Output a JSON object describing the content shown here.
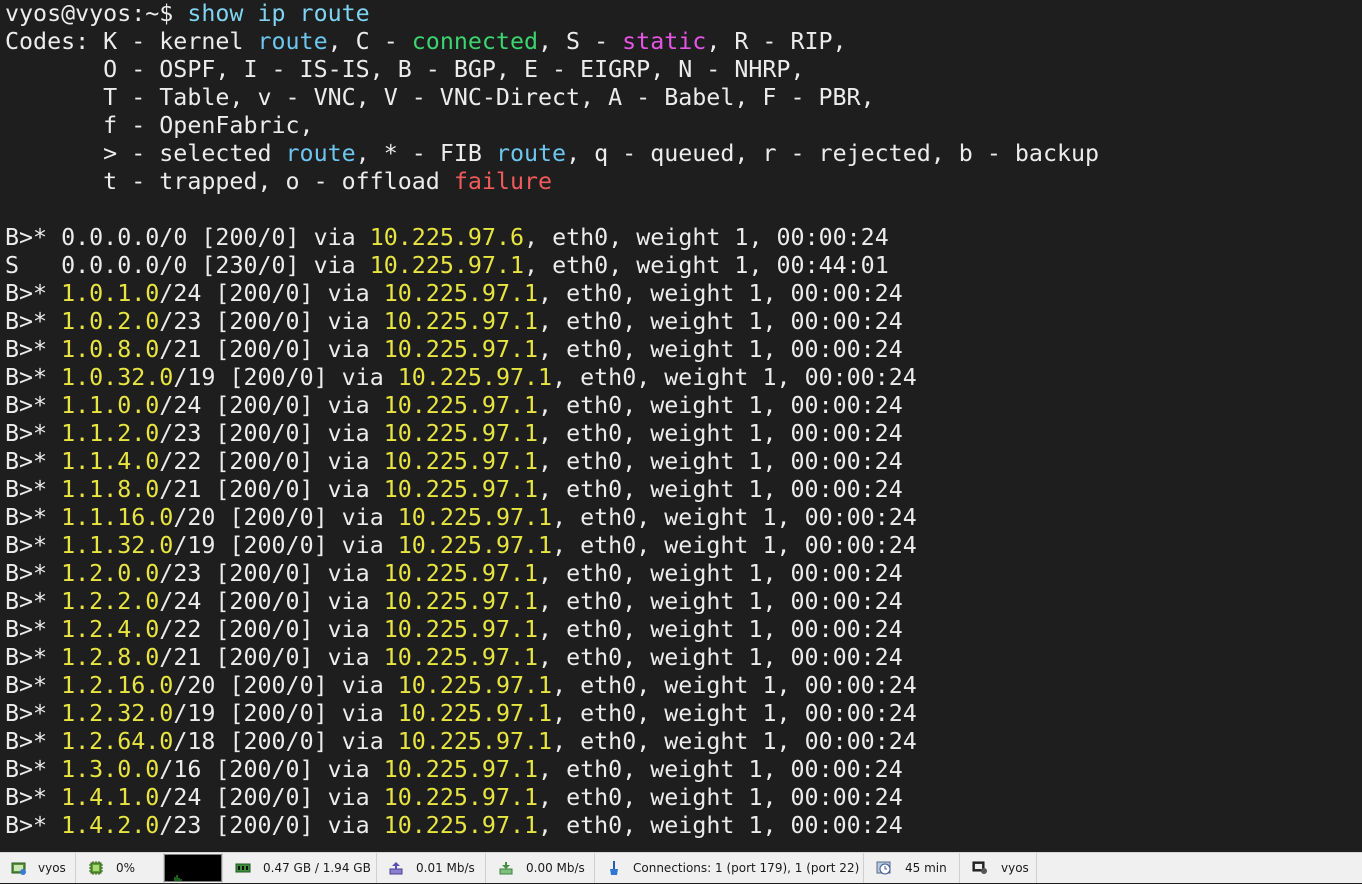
{
  "terminal": {
    "prompt": "vyos@vyos:~$ ",
    "command": "show ip route",
    "codes": [
      [
        [
          "Codes: K - kernel ",
          ""
        ],
        [
          "route",
          "c-blue"
        ],
        [
          ", C - ",
          ""
        ],
        [
          "connected",
          "c-green"
        ],
        [
          ", S - ",
          ""
        ],
        [
          "static",
          "c-mag"
        ],
        [
          ", R - RIP,",
          ""
        ]
      ],
      [
        [
          "       O - OSPF, I - IS-IS, B - BGP, E - EIGRP, N - NHRP,",
          ""
        ]
      ],
      [
        [
          "       T - Table, v - VNC, V - VNC-Direct, A - Babel, F - PBR,",
          ""
        ]
      ],
      [
        [
          "       f - OpenFabric,",
          ""
        ]
      ],
      [
        [
          "       > - selected ",
          ""
        ],
        [
          "route",
          "c-blue"
        ],
        [
          ", * - FIB ",
          ""
        ],
        [
          "route",
          "c-blue"
        ],
        [
          ", q - queued, r - rejected, b - backup",
          ""
        ]
      ],
      [
        [
          "       t - trapped, o - offload ",
          ""
        ],
        [
          "failure",
          "c-red"
        ]
      ]
    ],
    "routes": [
      {
        "code": "B>* ",
        "net": "0.0.0.0",
        "mask": "/0",
        "hl_net": false,
        "metric": "[200/0]",
        "via": "10.225.97.6",
        "iface": "eth0",
        "weight": "1",
        "age": "00:00:24"
      },
      {
        "code": "S   ",
        "net": "0.0.0.0",
        "mask": "/0",
        "hl_net": false,
        "metric": "[230/0]",
        "via": "10.225.97.1",
        "iface": "eth0",
        "weight": "1",
        "age": "00:44:01"
      },
      {
        "code": "B>* ",
        "net": "1.0.1.0",
        "mask": "/24",
        "hl_net": true,
        "metric": "[200/0]",
        "via": "10.225.97.1",
        "iface": "eth0",
        "weight": "1",
        "age": "00:00:24"
      },
      {
        "code": "B>* ",
        "net": "1.0.2.0",
        "mask": "/23",
        "hl_net": true,
        "metric": "[200/0]",
        "via": "10.225.97.1",
        "iface": "eth0",
        "weight": "1",
        "age": "00:00:24"
      },
      {
        "code": "B>* ",
        "net": "1.0.8.0",
        "mask": "/21",
        "hl_net": true,
        "metric": "[200/0]",
        "via": "10.225.97.1",
        "iface": "eth0",
        "weight": "1",
        "age": "00:00:24"
      },
      {
        "code": "B>* ",
        "net": "1.0.32.0",
        "mask": "/19",
        "hl_net": true,
        "metric": "[200/0]",
        "via": "10.225.97.1",
        "iface": "eth0",
        "weight": "1",
        "age": "00:00:24"
      },
      {
        "code": "B>* ",
        "net": "1.1.0.0",
        "mask": "/24",
        "hl_net": true,
        "metric": "[200/0]",
        "via": "10.225.97.1",
        "iface": "eth0",
        "weight": "1",
        "age": "00:00:24"
      },
      {
        "code": "B>* ",
        "net": "1.1.2.0",
        "mask": "/23",
        "hl_net": true,
        "metric": "[200/0]",
        "via": "10.225.97.1",
        "iface": "eth0",
        "weight": "1",
        "age": "00:00:24"
      },
      {
        "code": "B>* ",
        "net": "1.1.4.0",
        "mask": "/22",
        "hl_net": true,
        "metric": "[200/0]",
        "via": "10.225.97.1",
        "iface": "eth0",
        "weight": "1",
        "age": "00:00:24"
      },
      {
        "code": "B>* ",
        "net": "1.1.8.0",
        "mask": "/21",
        "hl_net": true,
        "metric": "[200/0]",
        "via": "10.225.97.1",
        "iface": "eth0",
        "weight": "1",
        "age": "00:00:24"
      },
      {
        "code": "B>* ",
        "net": "1.1.16.0",
        "mask": "/20",
        "hl_net": true,
        "metric": "[200/0]",
        "via": "10.225.97.1",
        "iface": "eth0",
        "weight": "1",
        "age": "00:00:24"
      },
      {
        "code": "B>* ",
        "net": "1.1.32.0",
        "mask": "/19",
        "hl_net": true,
        "metric": "[200/0]",
        "via": "10.225.97.1",
        "iface": "eth0",
        "weight": "1",
        "age": "00:00:24"
      },
      {
        "code": "B>* ",
        "net": "1.2.0.0",
        "mask": "/23",
        "hl_net": true,
        "metric": "[200/0]",
        "via": "10.225.97.1",
        "iface": "eth0",
        "weight": "1",
        "age": "00:00:24"
      },
      {
        "code": "B>* ",
        "net": "1.2.2.0",
        "mask": "/24",
        "hl_net": true,
        "metric": "[200/0]",
        "via": "10.225.97.1",
        "iface": "eth0",
        "weight": "1",
        "age": "00:00:24"
      },
      {
        "code": "B>* ",
        "net": "1.2.4.0",
        "mask": "/22",
        "hl_net": true,
        "metric": "[200/0]",
        "via": "10.225.97.1",
        "iface": "eth0",
        "weight": "1",
        "age": "00:00:24"
      },
      {
        "code": "B>* ",
        "net": "1.2.8.0",
        "mask": "/21",
        "hl_net": true,
        "metric": "[200/0]",
        "via": "10.225.97.1",
        "iface": "eth0",
        "weight": "1",
        "age": "00:00:24"
      },
      {
        "code": "B>* ",
        "net": "1.2.16.0",
        "mask": "/20",
        "hl_net": true,
        "metric": "[200/0]",
        "via": "10.225.97.1",
        "iface": "eth0",
        "weight": "1",
        "age": "00:00:24"
      },
      {
        "code": "B>* ",
        "net": "1.2.32.0",
        "mask": "/19",
        "hl_net": true,
        "metric": "[200/0]",
        "via": "10.225.97.1",
        "iface": "eth0",
        "weight": "1",
        "age": "00:00:24"
      },
      {
        "code": "B>* ",
        "net": "1.2.64.0",
        "mask": "/18",
        "hl_net": true,
        "metric": "[200/0]",
        "via": "10.225.97.1",
        "iface": "eth0",
        "weight": "1",
        "age": "00:00:24"
      },
      {
        "code": "B>* ",
        "net": "1.3.0.0",
        "mask": "/16",
        "hl_net": true,
        "metric": "[200/0]",
        "via": "10.225.97.1",
        "iface": "eth0",
        "weight": "1",
        "age": "00:00:24"
      },
      {
        "code": "B>* ",
        "net": "1.4.1.0",
        "mask": "/24",
        "hl_net": true,
        "metric": "[200/0]",
        "via": "10.225.97.1",
        "iface": "eth0",
        "weight": "1",
        "age": "00:00:24"
      },
      {
        "code": "B>* ",
        "net": "1.4.2.0",
        "mask": "/23",
        "hl_net": true,
        "metric": "[200/0]",
        "via": "10.225.97.1",
        "iface": "eth0",
        "weight": "1",
        "age": "00:00:24"
      }
    ]
  },
  "statusbar": {
    "host": {
      "icon": "session-icon",
      "label": "vyos"
    },
    "cpu": {
      "icon": "cpu-icon",
      "label": "0%"
    },
    "memory": {
      "icon": "memory-icon",
      "label": "0.47 GB / 1.94 GB"
    },
    "upload": {
      "icon": "upload-icon",
      "label": "0.01 Mb/s"
    },
    "download": {
      "icon": "download-icon",
      "label": "0.00 Mb/s"
    },
    "connections": {
      "icon": "connections-icon",
      "label": "Connections: 1 (port 179), 1 (port 22)"
    },
    "uptime": {
      "icon": "clock-icon",
      "label": "45 min"
    },
    "user": {
      "icon": "user-icon",
      "label": "vyos"
    }
  },
  "colors": {
    "background": "#1e1e1e",
    "text": "#ececec",
    "command": "#7fd4f2",
    "ip_highlight": "#e8e540",
    "route_keyword": "#6cc6ef",
    "connected": "#3bd56f",
    "static": "#e455e4",
    "failure": "#f05a5a"
  }
}
